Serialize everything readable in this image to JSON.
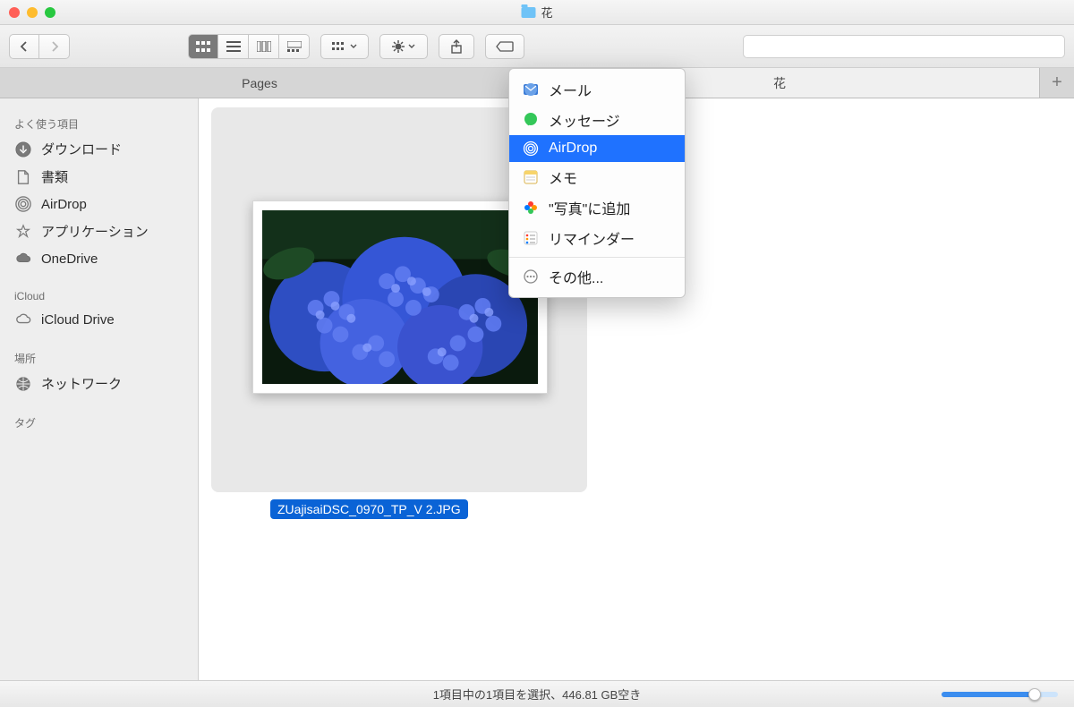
{
  "window": {
    "title": "花"
  },
  "toolbar": {
    "nav_back": "‹",
    "nav_forward": "›"
  },
  "tabs": [
    {
      "label": "Pages",
      "active": false
    },
    {
      "label": "花",
      "active": true
    }
  ],
  "sidebar": {
    "sections": [
      {
        "header": "よく使う項目",
        "items": [
          {
            "icon": "download-icon",
            "label": "ダウンロード"
          },
          {
            "icon": "documents-icon",
            "label": "書類"
          },
          {
            "icon": "airdrop-icon",
            "label": "AirDrop"
          },
          {
            "icon": "applications-icon",
            "label": "アプリケーション"
          },
          {
            "icon": "cloud-icon",
            "label": "OneDrive"
          }
        ]
      },
      {
        "header": "iCloud",
        "items": [
          {
            "icon": "cloud-icon",
            "label": "iCloud Drive"
          }
        ]
      },
      {
        "header": "場所",
        "items": [
          {
            "icon": "network-icon",
            "label": "ネットワーク"
          }
        ]
      },
      {
        "header": "タグ",
        "items": []
      }
    ]
  },
  "content": {
    "selected_file": "ZUajisaiDSC_0970_TP_V 2.JPG"
  },
  "share_menu": {
    "items": [
      {
        "icon": "mail-icon",
        "label": "メール",
        "selected": false
      },
      {
        "icon": "messages-icon",
        "label": "メッセージ",
        "selected": false
      },
      {
        "icon": "airdrop-icon",
        "label": "AirDrop",
        "selected": true
      },
      {
        "icon": "notes-icon",
        "label": "メモ",
        "selected": false
      },
      {
        "icon": "photos-icon",
        "label": "\"写真\"に追加",
        "selected": false
      },
      {
        "icon": "reminders-icon",
        "label": "リマインダー",
        "selected": false
      }
    ],
    "more_label": "その他..."
  },
  "status": {
    "text": "1項目中の1項目を選択、446.81 GB空き"
  }
}
